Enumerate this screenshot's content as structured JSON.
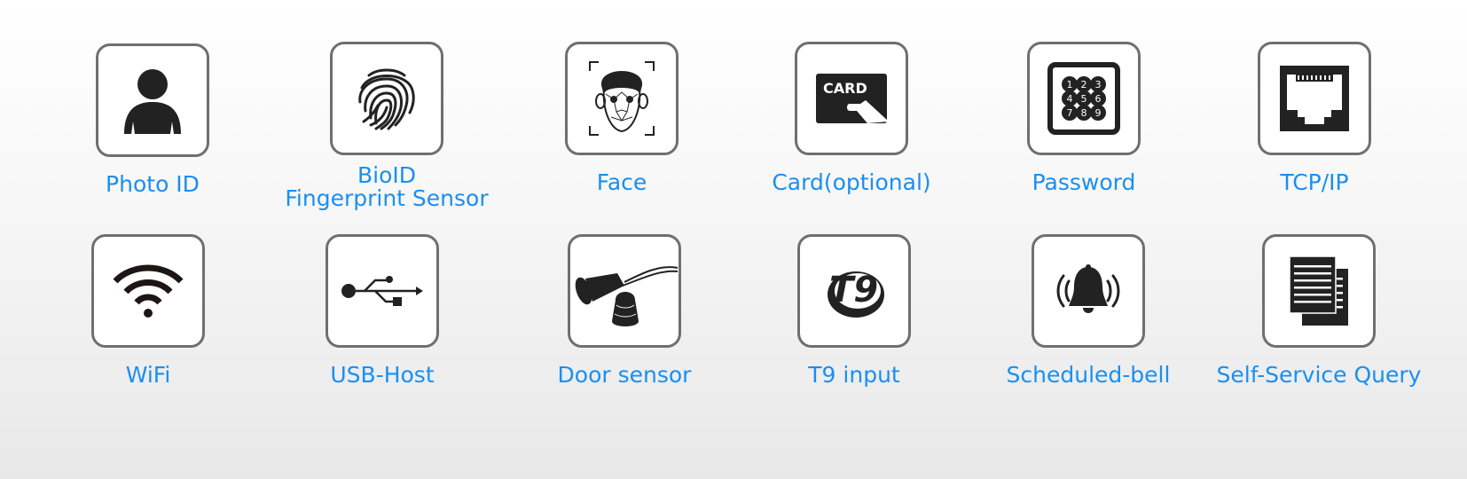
{
  "accent_color": "#1a8ff0",
  "features": [
    {
      "id": "photo-id",
      "icon": "person-icon",
      "label": "Photo ID"
    },
    {
      "id": "fingerprint",
      "icon": "fingerprint-icon",
      "label_line1": "BioID",
      "label_line2": "Fingerprint Sensor"
    },
    {
      "id": "face",
      "icon": "face-recognition-icon",
      "label": "Face"
    },
    {
      "id": "card",
      "icon": "card-icon",
      "label": "Card(optional)",
      "icon_text": "CARD"
    },
    {
      "id": "password",
      "icon": "keypad-icon",
      "label": "Password",
      "keys": [
        "1",
        "2",
        "3",
        "4",
        "5",
        "6",
        "7",
        "8",
        "9"
      ]
    },
    {
      "id": "tcpip",
      "icon": "ethernet-port-icon",
      "label": "TCP/IP"
    },
    {
      "id": "wifi",
      "icon": "wifi-icon",
      "label": "WiFi"
    },
    {
      "id": "usb",
      "icon": "usb-icon",
      "label": "USB-Host"
    },
    {
      "id": "door-sensor",
      "icon": "door-sensor-icon",
      "label": "Door sensor"
    },
    {
      "id": "t9",
      "icon": "t9-icon",
      "label": "T9 input",
      "icon_text": "T9"
    },
    {
      "id": "bell",
      "icon": "bell-icon",
      "label": "Scheduled-bell"
    },
    {
      "id": "query",
      "icon": "document-icon",
      "label": "Self-Service Query"
    }
  ]
}
